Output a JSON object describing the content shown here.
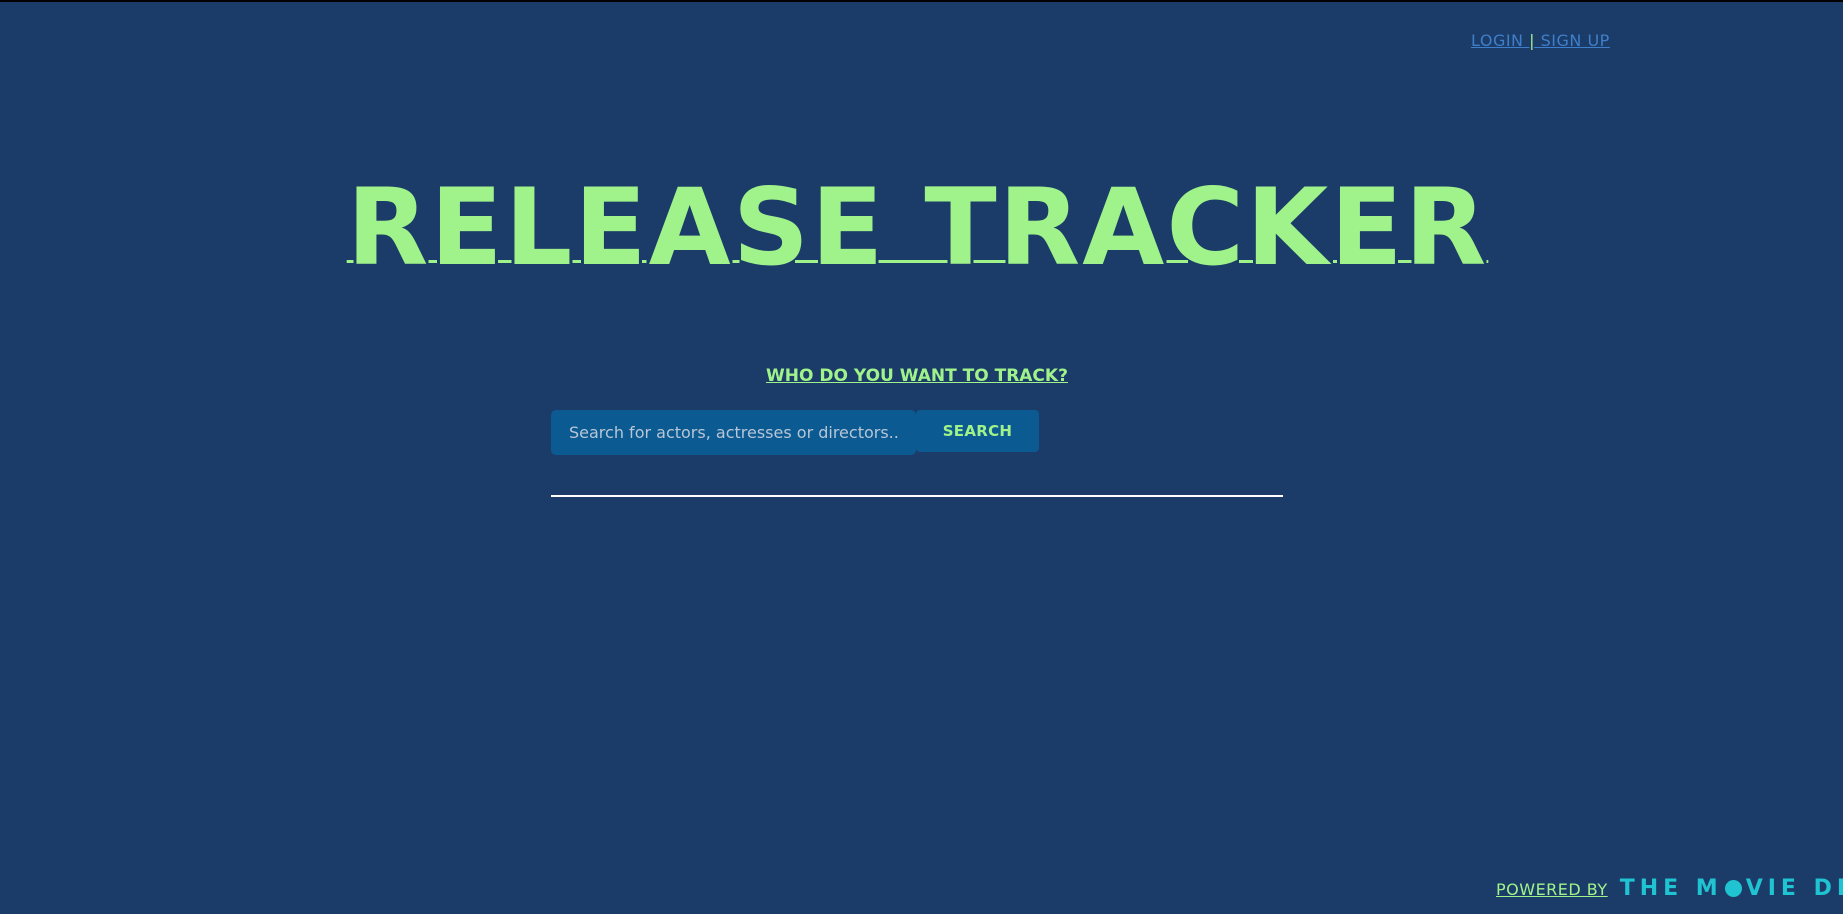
{
  "header": {
    "login_label": "LOGIN",
    "separator": "|",
    "signup_label": "SIGN UP"
  },
  "hero": {
    "title": "RELEASE TRACKER",
    "subtitle": "WHO DO YOU WANT TO TRACK?"
  },
  "search": {
    "placeholder": "Search for actors, actresses or directors...",
    "value": "",
    "button_label": "SEARCH"
  },
  "footer": {
    "powered_by": "POWERED BY",
    "logo_text_part1": "THE M",
    "logo_text_part2": "VIE DB"
  },
  "colors": {
    "background": "#1b3c69",
    "accent_green": "#a0f38a",
    "link_blue": "#3f7fc9",
    "input_blue": "#0b5a91",
    "tmdb_teal": "#1fc3d1"
  }
}
